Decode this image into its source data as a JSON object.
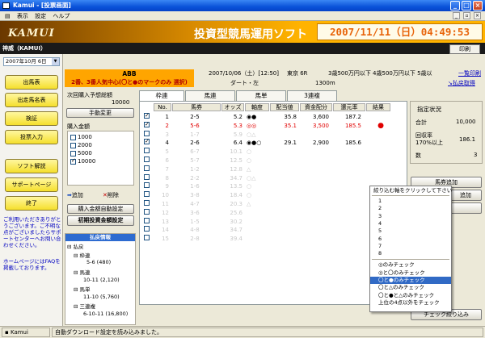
{
  "window": {
    "title": "Kamui - [投票画面]"
  },
  "menu": {
    "items": [
      "表示",
      "設定",
      "ヘルプ"
    ]
  },
  "banner": {
    "logo": "KAMUI",
    "tagline": "投資型競馬運用ソフト",
    "datetime": "2007/11/11（日）04:49:53"
  },
  "user": {
    "name": "神威（KAMUI）",
    "print_label": "印刷"
  },
  "sidebar": {
    "date_select": "2007年10月 6日",
    "buttons": [
      "出馬表",
      "出走馬名表",
      "検証",
      "投票入力",
      "ソフト解説",
      "サポートページ",
      "終了"
    ],
    "help_text": "ご利用いただきありがとうございます。ご不明な点がございましたらサポートセンターへお問い合わせください。",
    "help_text2": "ホームページにはFAQを掲載しております。"
  },
  "race": {
    "code": "ABB",
    "condition": "2番、3番人気中心(〇と●のマークのみ 選択)",
    "date": "2007/10/06（土）[12:50]",
    "venue": "東京 6R",
    "class": "3歳500万円以下 4歳500万円以下 5歳以",
    "surface": "ダート・左",
    "distance": "1300m",
    "link_print": "一覧印刷",
    "link_refund": "払戻取得"
  },
  "capital": {
    "label": "次回購入予想総額",
    "value": "10000",
    "button": "手動変更"
  },
  "purchase": {
    "label": "購入金額",
    "options": [
      {
        "value": "1000",
        "checked": false
      },
      {
        "value": "2000",
        "checked": false
      },
      {
        "value": "5000",
        "checked": false
      },
      {
        "value": "10000",
        "checked": true
      }
    ],
    "add_label": "追加",
    "delete_label": "削除",
    "auto_label": "購入金額自動設定",
    "init_label": "初期投資金額設定"
  },
  "refund": {
    "header": "払戻情報",
    "lines": [
      "払戻",
      "枠連",
      "5-6 (480)",
      "馬連",
      "10-11 (2,120)",
      "馬単",
      "11-10 (5,760)",
      "三連複",
      "6-10-11 (16,800)"
    ]
  },
  "tabs": [
    "枠連",
    "馬連",
    "馬単",
    "3連複"
  ],
  "table": {
    "headers": [
      "No.",
      "馬券",
      "オッズ",
      "軸度",
      "配当値",
      "資金配分",
      "還元率",
      "結果"
    ],
    "rows": [
      {
        "checked": true,
        "no": "1",
        "ticket": "2-5",
        "odds": "5.2",
        "axis": "◉●",
        "payout": "35.8",
        "alloc": "3,600",
        "rate": "187.2",
        "result": "",
        "style": "normal"
      },
      {
        "checked": true,
        "no": "2",
        "ticket": "5-6",
        "odds": "5.3",
        "axis": "◎◎",
        "payout": "35.1",
        "alloc": "3,500",
        "rate": "185.5",
        "result": "●",
        "style": "red"
      },
      {
        "checked": false,
        "no": "3",
        "ticket": "1-7",
        "odds": "5.9",
        "axis": "○△",
        "payout": "",
        "alloc": "",
        "rate": "",
        "result": "",
        "style": "ghost"
      },
      {
        "checked": true,
        "no": "4",
        "ticket": "2-6",
        "odds": "6.4",
        "axis": "◉●○",
        "payout": "29.1",
        "alloc": "2,900",
        "rate": "185.6",
        "result": "",
        "style": "normal"
      },
      {
        "checked": false,
        "no": "5",
        "ticket": "6-7",
        "odds": "10.1",
        "axis": "○",
        "payout": "",
        "alloc": "",
        "rate": "",
        "result": "",
        "style": "ghost"
      },
      {
        "checked": false,
        "no": "6",
        "ticket": "5-7",
        "odds": "12.5",
        "axis": "○",
        "payout": "",
        "alloc": "",
        "rate": "",
        "result": "",
        "style": "ghost"
      },
      {
        "checked": false,
        "no": "7",
        "ticket": "1-2",
        "odds": "12.8",
        "axis": "△",
        "payout": "",
        "alloc": "",
        "rate": "",
        "result": "",
        "style": "ghost"
      },
      {
        "checked": false,
        "no": "8",
        "ticket": "2-2",
        "odds": "34.7",
        "axis": "○△",
        "payout": "",
        "alloc": "",
        "rate": "",
        "result": "",
        "style": "ghost"
      },
      {
        "checked": false,
        "no": "9",
        "ticket": "1-6",
        "odds": "13.5",
        "axis": "○",
        "payout": "",
        "alloc": "",
        "rate": "",
        "result": "",
        "style": "ghost"
      },
      {
        "checked": false,
        "no": "10",
        "ticket": "3-8",
        "odds": "18.4",
        "axis": "○",
        "payout": "",
        "alloc": "",
        "rate": "",
        "result": "",
        "style": "ghost"
      },
      {
        "checked": false,
        "no": "11",
        "ticket": "4-7",
        "odds": "20.3",
        "axis": "△",
        "payout": "",
        "alloc": "",
        "rate": "",
        "result": "",
        "style": "ghost"
      },
      {
        "checked": false,
        "no": "12",
        "ticket": "3-6",
        "odds": "25.6",
        "axis": "",
        "payout": "",
        "alloc": "",
        "rate": "",
        "result": "",
        "style": "ghost"
      },
      {
        "checked": false,
        "no": "13",
        "ticket": "1-5",
        "odds": "30.2",
        "axis": "",
        "payout": "",
        "alloc": "",
        "rate": "",
        "result": "",
        "style": "ghost"
      },
      {
        "checked": false,
        "no": "14",
        "ticket": "4-8",
        "odds": "34.7",
        "axis": "",
        "payout": "",
        "alloc": "",
        "rate": "",
        "result": "",
        "style": "ghost"
      },
      {
        "checked": false,
        "no": "15",
        "ticket": "2-8",
        "odds": "39.4",
        "axis": "",
        "payout": "",
        "alloc": "",
        "rate": "",
        "result": "",
        "style": "ghost"
      }
    ]
  },
  "stats": {
    "title": "指定状況",
    "total_label": "合計",
    "total_value": "10,000",
    "rate_label": "回収率",
    "rate_sub": "170%以上",
    "rate_value": "186.1",
    "count_label": "数",
    "count_value": "3"
  },
  "side_buttons": {
    "add_ticket": "馬券追加",
    "add": "追加",
    "check_narrow": "チェック絞り込み"
  },
  "context_menu": {
    "header": "絞り込む軸をクリックして下さい",
    "numbers": [
      "1",
      "2",
      "3",
      "4",
      "5",
      "6",
      "7",
      "8"
    ],
    "marks": [
      "◎のみチェック",
      "◎と〇のみチェック",
      "〇と●のみチェック",
      "〇と△のみチェック",
      "〇と●と△のみチェック",
      "上位の4点以外をチェック"
    ],
    "selected_index": 2
  },
  "status": {
    "app": "Kamui",
    "message": "自動ダウンロード設定を読み込みました。"
  }
}
